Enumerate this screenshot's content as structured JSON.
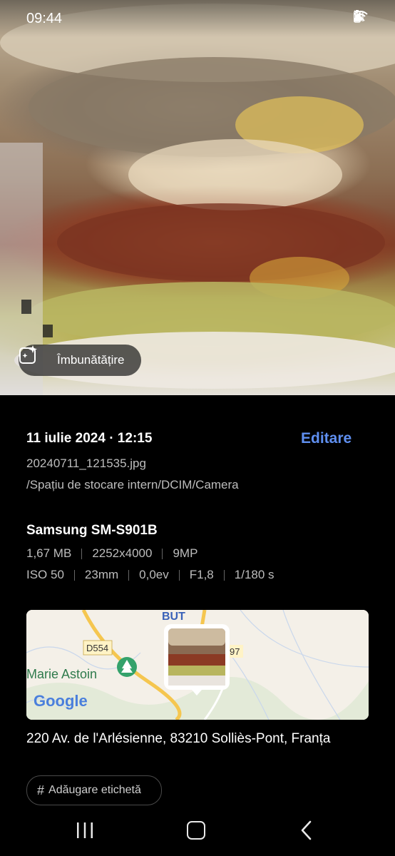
{
  "status_bar": {
    "time": "09:44"
  },
  "photo": {
    "enhance_label": "Îmbunătățire"
  },
  "details": {
    "date_time": "11 iulie 2024 · 12:15",
    "edit_label": "Editare",
    "filename": "20240711_121535.jpg",
    "path": "/Spațiu de stocare intern/DCIM/Camera",
    "device": "Samsung SM-S901B",
    "file_specs": [
      "1,67 MB",
      "2252x4000",
      "9MP"
    ],
    "camera_specs": [
      "ISO 50",
      "23mm",
      "0,0ev",
      "F1,8",
      "1/180 s"
    ]
  },
  "map": {
    "labels": {
      "road": "D554",
      "place": "Marie Astoin",
      "road2": "97",
      "poi": "BUT",
      "brand": "Google"
    }
  },
  "location": {
    "address": "220 Av. de l'Arlésienne, 83210 Solliès-Pont, Franța"
  },
  "tag": {
    "hash": "#",
    "label": "Adăugare etichetă"
  },
  "colors": {
    "accent": "#5f8ff0",
    "background": "#000000",
    "secondary_text": "#bdbdbd"
  },
  "icons": [
    "mute-icon",
    "wifi-icon",
    "signal-icon",
    "battery-icon",
    "enhance-sparkle-icon",
    "recent-apps-icon",
    "home-icon",
    "back-icon",
    "tree-icon",
    "place-pin-icon"
  ]
}
